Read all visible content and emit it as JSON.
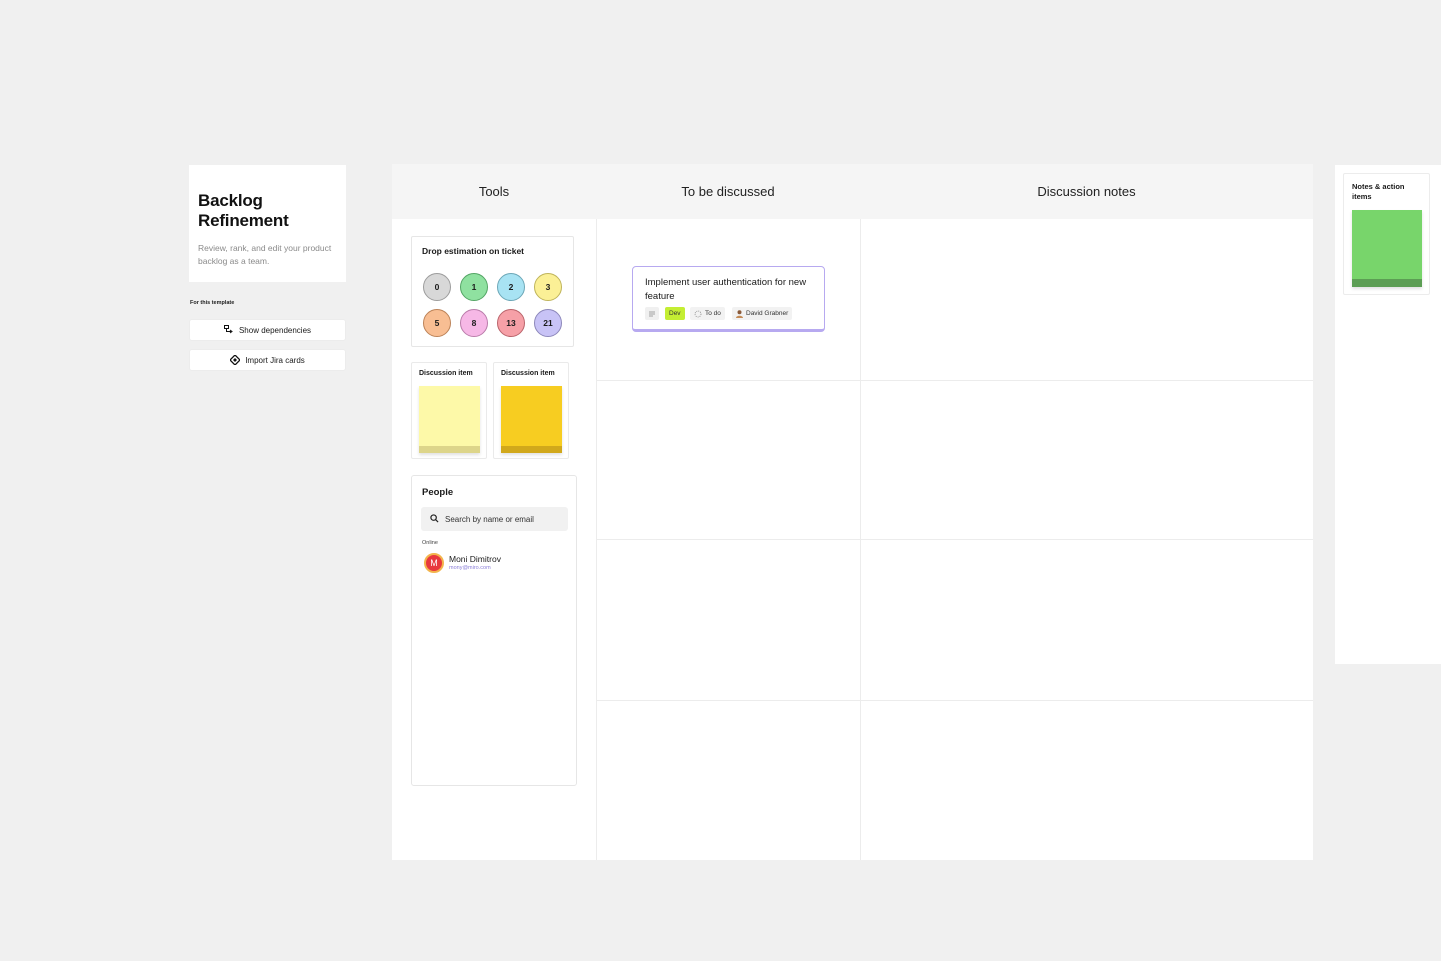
{
  "template": {
    "title": "Backlog Refinement",
    "description": "Review, rank, and edit your product backlog as a team.",
    "section_label": "For this template",
    "buttons": [
      {
        "label": "Show dependencies",
        "icon": "dependencies-icon"
      },
      {
        "label": "Import Jira cards",
        "icon": "jira-icon"
      }
    ]
  },
  "board": {
    "columns": [
      "Tools",
      "To be discussed",
      "Discussion notes"
    ]
  },
  "estimation": {
    "label": "Drop estimation on ticket",
    "values": [
      "0",
      "1",
      "2",
      "3",
      "5",
      "8",
      "13",
      "21"
    ],
    "colors": [
      "#d8d8d8",
      "#8fe1a0",
      "#a8e3f3",
      "#fbf096",
      "#f8be93",
      "#f6b8e6",
      "#f6a0a7",
      "#c8c3f6"
    ]
  },
  "discussion_items": [
    {
      "label": "Discussion item",
      "color": "#fdf9a8",
      "base": "#ddd58a"
    },
    {
      "label": "Discussion item",
      "color": "#f7cd21",
      "base": "#d1a81b"
    }
  ],
  "people": {
    "label": "People",
    "search_placeholder": "Search by name or email",
    "status_label": "Online",
    "users": [
      {
        "initial": "M",
        "name": "Moni Dimitrov",
        "email": "mony@miro.com"
      }
    ]
  },
  "ticket": {
    "title": "Implement user authentication for new feature",
    "tag": "Dev",
    "status": "To do",
    "assignee": "David Grabner"
  },
  "notes": {
    "label": "Notes & action items"
  }
}
